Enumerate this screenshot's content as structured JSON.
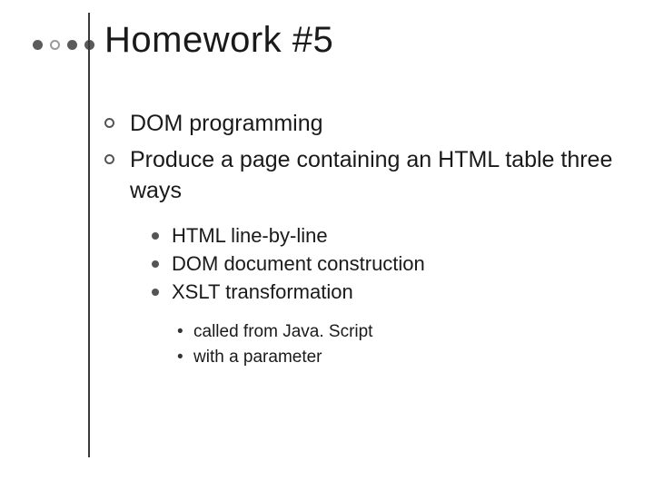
{
  "title": "Homework #5",
  "bullets_l1": [
    "DOM programming",
    "Produce a page containing an HTML table three ways"
  ],
  "bullets_l2": [
    "HTML line-by-line",
    "DOM document construction",
    "XSLT transformation"
  ],
  "bullets_l3": [
    "called from Java. Script",
    "with a parameter"
  ]
}
